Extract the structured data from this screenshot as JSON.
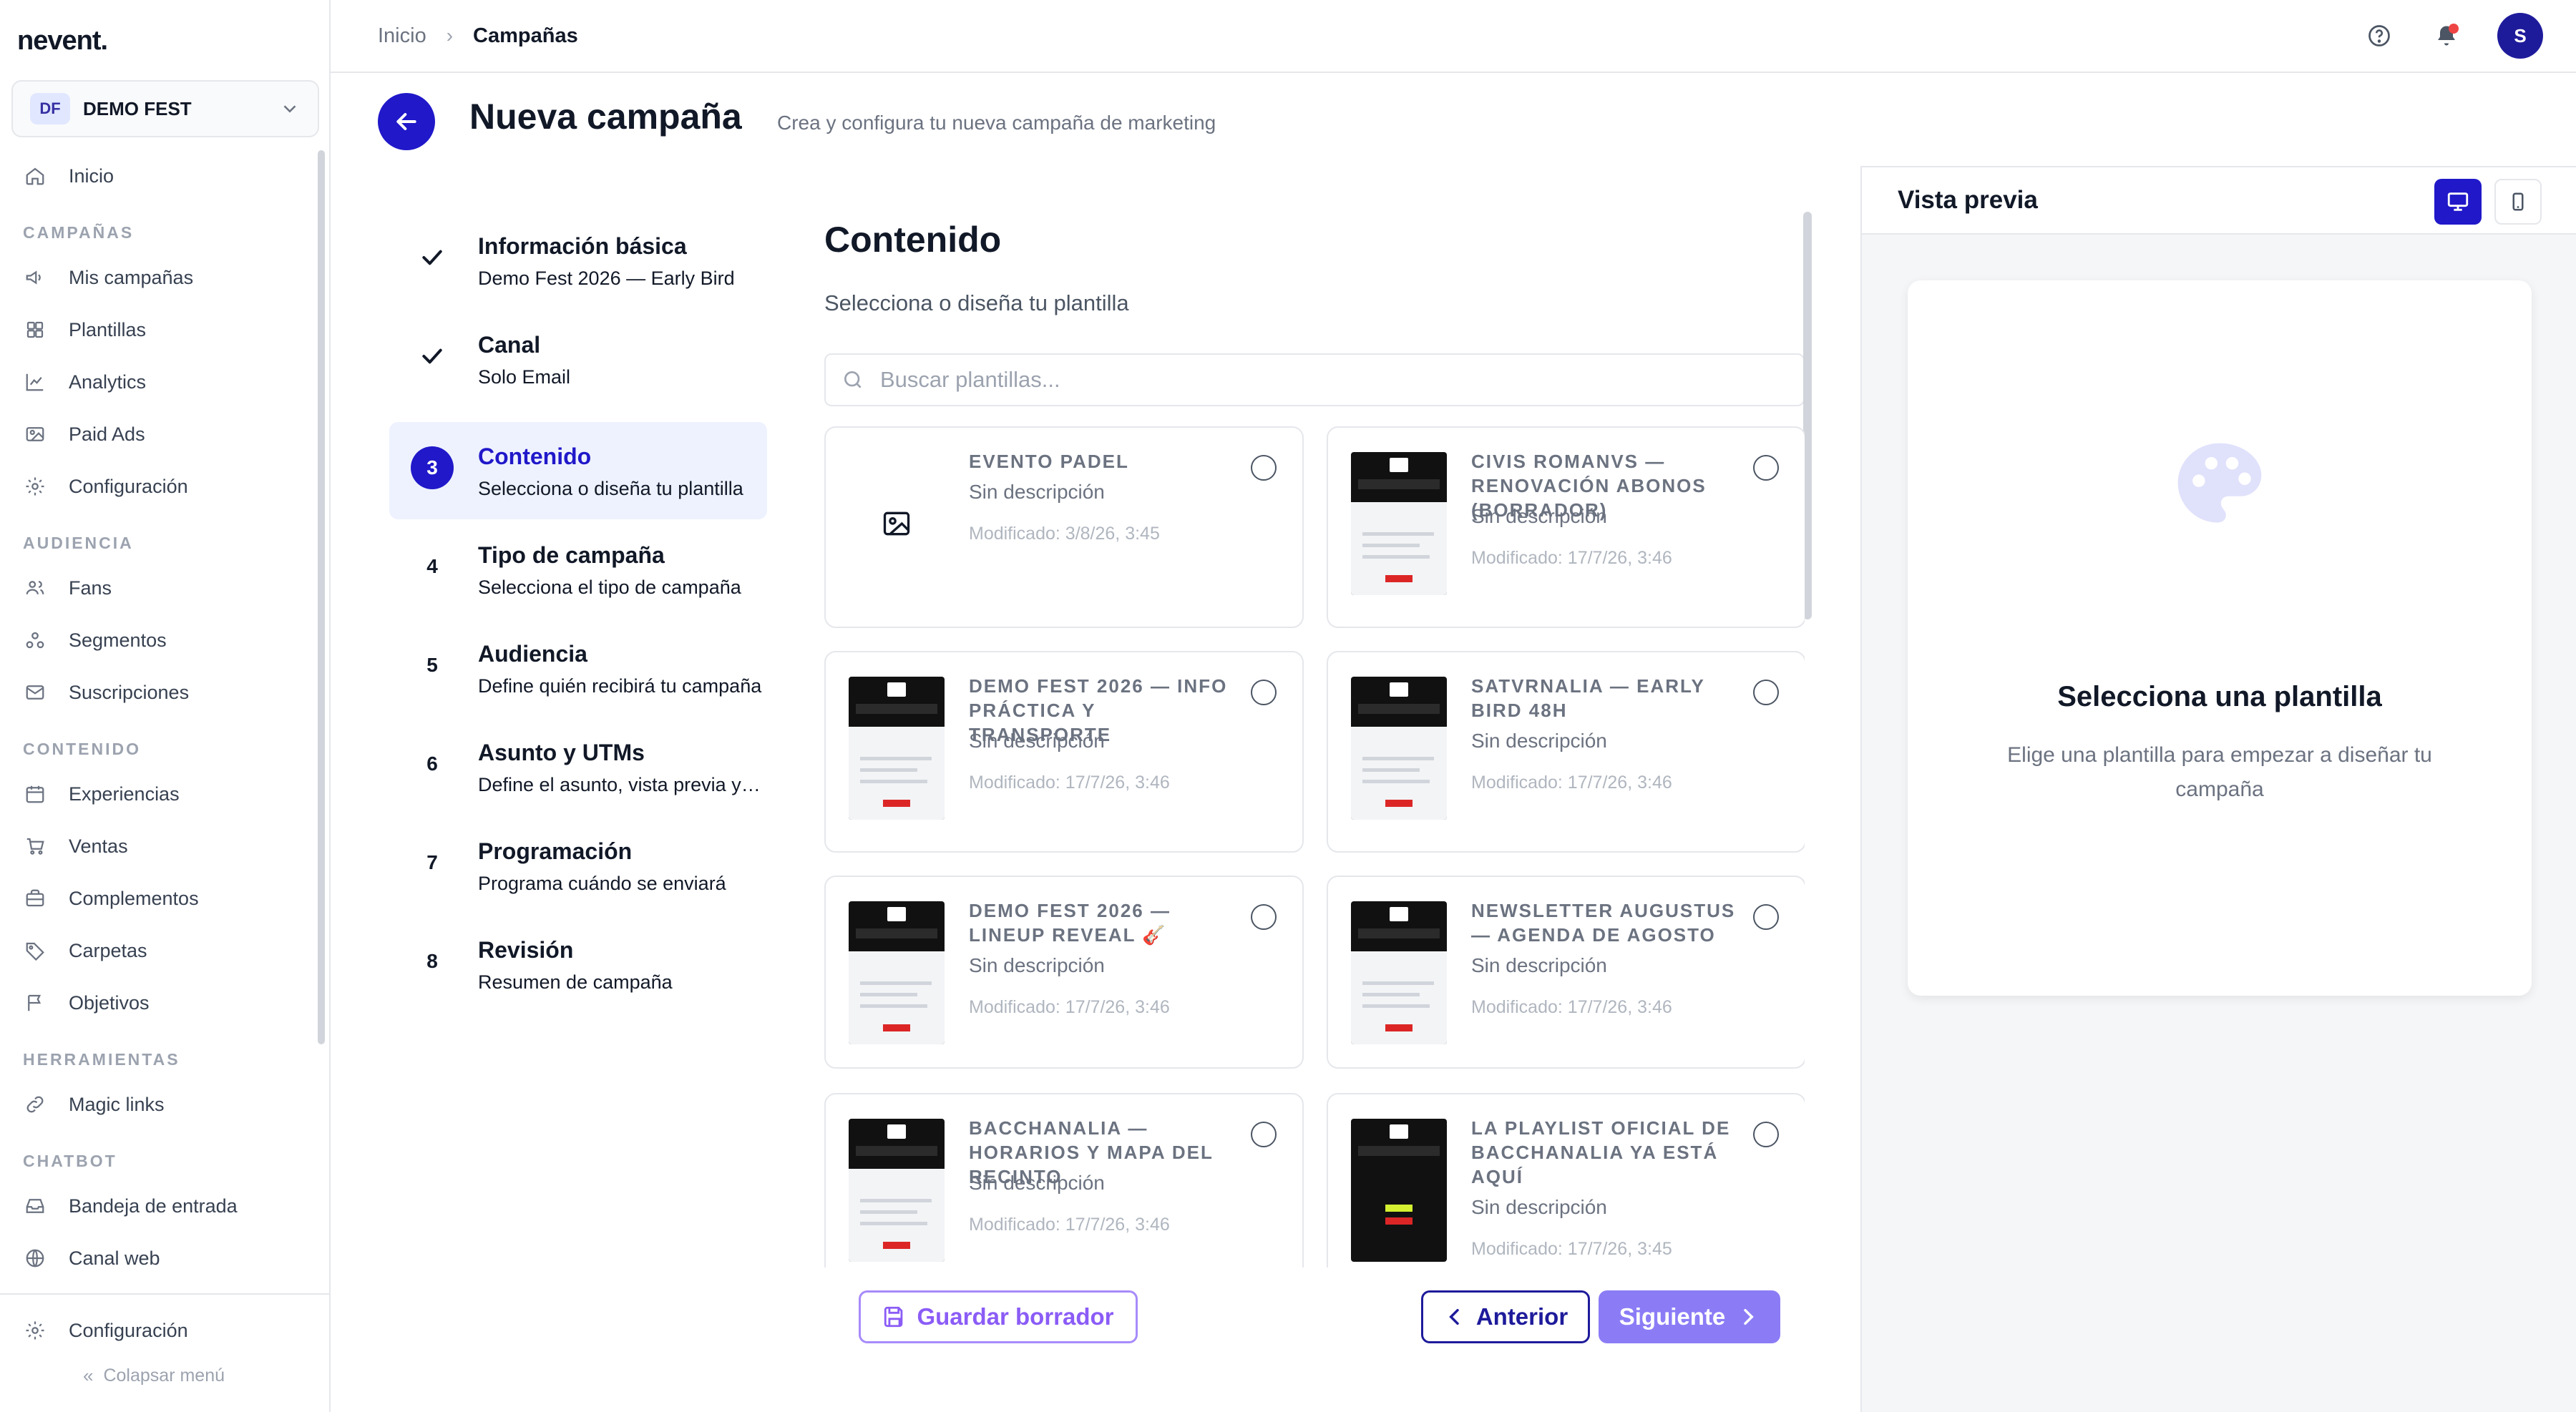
{
  "app": {
    "logo": "nevent."
  },
  "org": {
    "initials": "DF",
    "name": "DEMO FEST"
  },
  "sidebar": {
    "inicio": "Inicio",
    "sections": {
      "campanas": "CAMPAÑAS",
      "audiencia": "AUDIENCIA",
      "contenido": "CONTENIDO",
      "herramientas": "HERRAMIENTAS",
      "chatbot": "CHATBOT"
    },
    "items": {
      "mis_campanas": "Mis campañas",
      "plantillas": "Plantillas",
      "analytics": "Analytics",
      "paid_ads": "Paid Ads",
      "configuracion_camp": "Configuración",
      "fans": "Fans",
      "segmentos": "Segmentos",
      "suscripciones": "Suscripciones",
      "experiencias": "Experiencias",
      "ventas": "Ventas",
      "complementos": "Complementos",
      "carpetas": "Carpetas",
      "objetivos": "Objetivos",
      "magic_links": "Magic links",
      "bandeja": "Bandeja de entrada",
      "canal_web": "Canal web"
    },
    "configuracion": "Configuración",
    "collapse": "Colapsar menú"
  },
  "topbar": {
    "breadcrumb_home": "Inicio",
    "breadcrumb_current": "Campañas",
    "avatar_initial": "S"
  },
  "header": {
    "title": "Nueva campaña",
    "subtitle": "Crea y configura tu nueva campaña de marketing"
  },
  "steps": [
    {
      "marker": "",
      "title": "Información básica",
      "subtitle": "Demo Fest 2026 — Early Bird",
      "state": "done"
    },
    {
      "marker": "",
      "title": "Canal",
      "subtitle": "Solo Email",
      "state": "done"
    },
    {
      "marker": "3",
      "title": "Contenido",
      "subtitle": "Selecciona o diseña tu plantilla",
      "state": "active"
    },
    {
      "marker": "4",
      "title": "Tipo de campaña",
      "subtitle": "Selecciona el tipo de campaña",
      "state": "pending"
    },
    {
      "marker": "5",
      "title": "Audiencia",
      "subtitle": "Define quién recibirá tu campaña",
      "state": "pending"
    },
    {
      "marker": "6",
      "title": "Asunto y UTMs",
      "subtitle": "Define el asunto, vista previa y UTMs",
      "state": "pending"
    },
    {
      "marker": "7",
      "title": "Programación",
      "subtitle": "Programa cuándo se enviará",
      "state": "pending"
    },
    {
      "marker": "8",
      "title": "Revisión",
      "subtitle": "Resumen de campaña",
      "state": "pending"
    }
  ],
  "content": {
    "title": "Contenido",
    "subtitle": "Selecciona o diseña tu plantilla",
    "search_placeholder": "Buscar plantillas..."
  },
  "templates": [
    {
      "title": "EVENTO PADEL",
      "desc": "Sin descripción",
      "date": "Modificado: 3/8/26, 3:45",
      "thumb": "none"
    },
    {
      "title": "CIVIS ROMANVS — RENOVACIÓN ABONOS (BORRADOR)",
      "desc": "Sin descripción",
      "date": "Modificado: 17/7/26, 3:46",
      "thumb": "dark"
    },
    {
      "title": "DEMO FEST 2026 — INFO PRÁCTICA Y TRANSPORTE",
      "desc": "Sin descripción",
      "date": "Modificado: 17/7/26, 3:46",
      "thumb": "dark"
    },
    {
      "title": "SATVRNALIA — EARLY BIRD 48H",
      "desc": "Sin descripción",
      "date": "Modificado: 17/7/26, 3:46",
      "thumb": "lime"
    },
    {
      "title": "DEMO FEST 2026 — LINEUP REVEAL 🎸",
      "desc": "Sin descripción",
      "date": "Modificado: 17/7/26, 3:46",
      "thumb": "dark"
    },
    {
      "title": "NEWSLETTER AUGUSTUS — AGENDA DE AGOSTO",
      "desc": "Sin descripción",
      "date": "Modificado: 17/7/26, 3:46",
      "thumb": "dark"
    },
    {
      "title": "BACCHANALIA — HORARIOS Y MAPA DEL RECINTO",
      "desc": "Sin descripción",
      "date": "Modificado: 17/7/26, 3:46",
      "thumb": "dark"
    },
    {
      "title": "LA PLAYLIST OFICIAL DE BACCHANALIA YA ESTÁ AQUÍ",
      "desc": "Sin descripción",
      "date": "Modificado: 17/7/26, 3:45",
      "thumb": "black"
    }
  ],
  "footer": {
    "draft": "Guardar borrador",
    "prev": "Anterior",
    "next": "Siguiente"
  },
  "preview": {
    "title": "Vista previa",
    "empty_title": "Selecciona una plantilla",
    "empty_sub": "Elige una plantilla para empezar a diseñar tu campaña"
  },
  "colors": {
    "primary": "#2018c9",
    "primary_dark": "#1e1b9b",
    "accent_purple": "#8b5cf6",
    "notification": "#ef4444"
  }
}
